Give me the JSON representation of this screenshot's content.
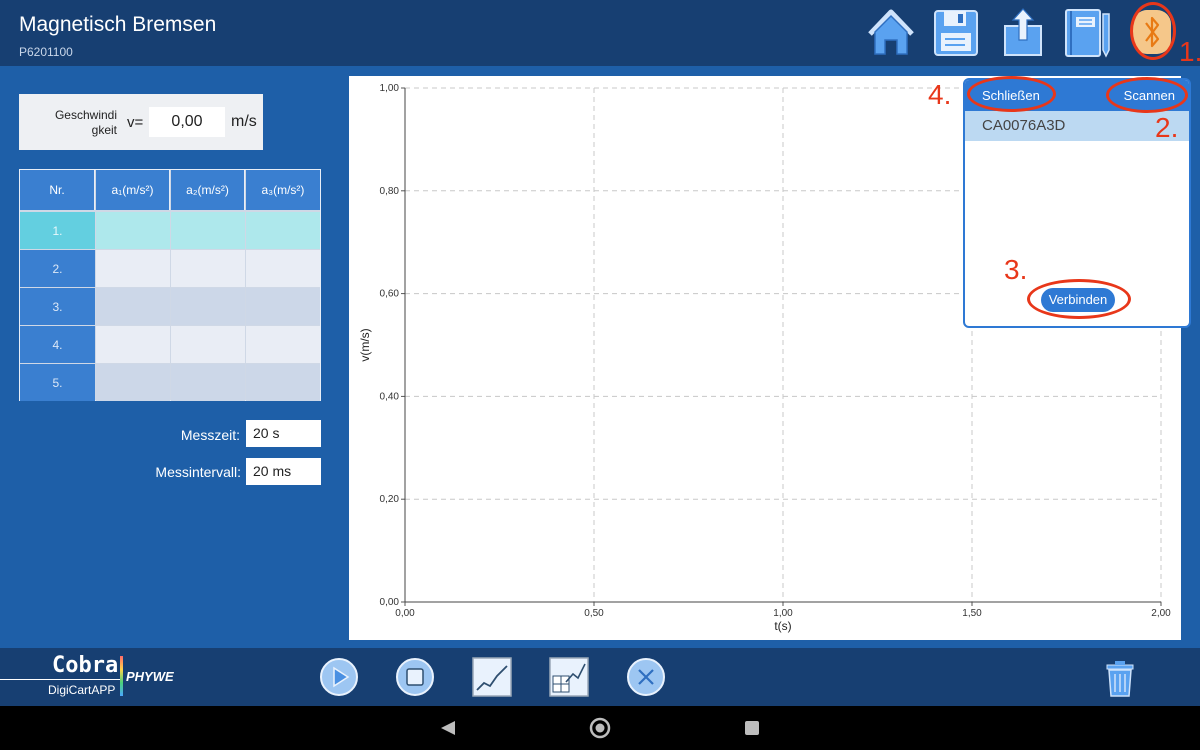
{
  "header": {
    "title": "Magnetisch Bremsen",
    "subtitle": "P6201100",
    "icons": [
      "home-icon",
      "save-icon",
      "export-icon",
      "notebook-icon",
      "bluetooth-icon"
    ]
  },
  "speed": {
    "label": "Geschwindigkeit",
    "label_line1": "Geschwindi",
    "label_line2": "gkeit",
    "symbol": "v=",
    "value": "0,00",
    "unit": "m/s"
  },
  "table": {
    "headers": [
      "Nr.",
      "a₁(m/s²)",
      "a₂(m/s²)",
      "a₃(m/s²)"
    ],
    "rows": [
      "1.",
      "2.",
      "3.",
      "4.",
      "5."
    ]
  },
  "settings": {
    "messzeit_label": "Messzeit:",
    "messzeit_value": "20 s",
    "messintervall_label": "Messintervall:",
    "messintervall_value": "20 ms"
  },
  "chart_data": {
    "type": "line",
    "xlabel": "t(s)",
    "ylabel": "v(m/s)",
    "xlim": [
      0,
      2
    ],
    "ylim": [
      0,
      1
    ],
    "x_ticks": [
      "0,00",
      "0,50",
      "1,00",
      "1,50",
      "2,00"
    ],
    "y_ticks": [
      "0,00",
      "0,20",
      "0,40",
      "0,60",
      "0,80",
      "1,00"
    ],
    "grid": true,
    "series": []
  },
  "bluetooth": {
    "close_label": "Schließen",
    "scan_label": "Scannen",
    "device": "CA0076A3D",
    "connect_label": "Verbinden"
  },
  "annotations": [
    "1.",
    "2.",
    "3.",
    "4."
  ],
  "footer": {
    "logo_cobra": "Cobra",
    "logo_app": "DigiCartAPP",
    "logo_phywe": "PHYWE",
    "icons": [
      "play-icon",
      "stop-icon",
      "chart-icon",
      "table-chart-icon",
      "cancel-icon",
      "trash-icon"
    ]
  },
  "colors": {
    "background": "#1e5fa8",
    "header": "#173f72",
    "accent": "#2e79d4",
    "annotation": "#e8371a",
    "highlight_row": "#aee8ec"
  }
}
